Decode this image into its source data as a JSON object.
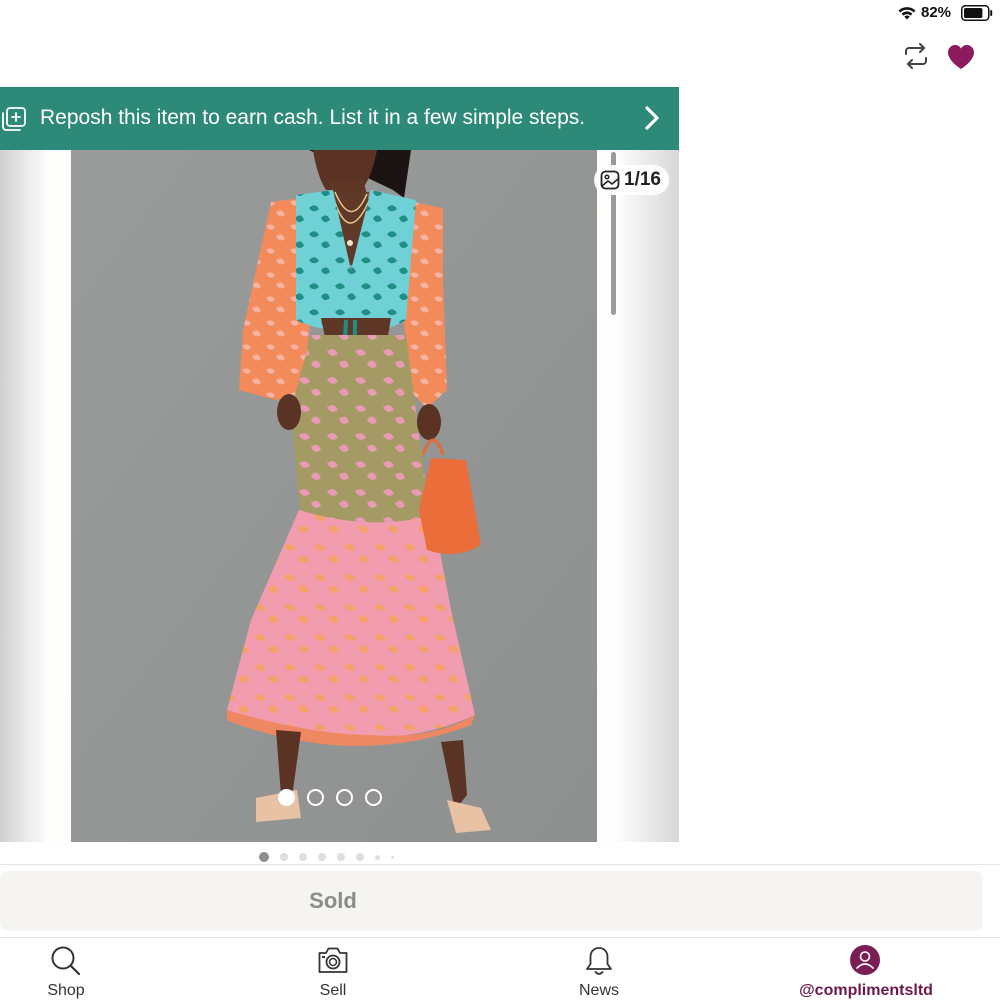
{
  "status_bar": {
    "battery_percent": "82%",
    "battery_level": 0.82
  },
  "header": {
    "actions": [
      {
        "name": "repost",
        "icon": "repeat-icon"
      },
      {
        "name": "like",
        "icon": "heart-icon",
        "color": "#8b1a5e"
      }
    ]
  },
  "banner": {
    "text": "Reposh this item to earn cash. List it in a few simple steps.",
    "background": "#2e8a78",
    "icon": "add-to-stack-icon",
    "chevron": "chevron-right-icon"
  },
  "viewer": {
    "counter": "1/16",
    "counter_icon": "image-icon",
    "photo_dots": {
      "count": 4,
      "active": 0
    },
    "page_dots": {
      "count": 8,
      "active": 0
    }
  },
  "actions": {
    "sold_label": "Sold"
  },
  "tabbar": {
    "tabs": [
      {
        "label": "Shop",
        "icon": "search-icon"
      },
      {
        "label": "Sell",
        "icon": "camera-icon"
      },
      {
        "label": "News",
        "icon": "bell-icon"
      },
      {
        "label": "@complimentsltd",
        "icon": "avatar-icon",
        "active": true,
        "color": "#6d1a4b"
      }
    ]
  }
}
